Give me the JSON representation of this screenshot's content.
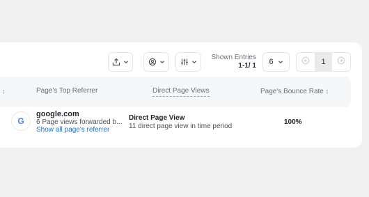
{
  "toolbar": {
    "export_icon": "export-icon",
    "filter_icon": "person-filter-icon",
    "columns_icon": "sliders-icon",
    "dropdown_icon": "chevron-down-icon"
  },
  "entries": {
    "label": "Shown Entries",
    "range": "1-1/ 1",
    "per_page": "6"
  },
  "pagination": {
    "current_page": "1"
  },
  "table": {
    "headers": {
      "referrer": "Page's Top Referrer",
      "views": "Direct Page Views",
      "bounce": "Page's Bounce Rate",
      "sort_symbol": "↕"
    },
    "rows": [
      {
        "icon_letter": "G",
        "domain": "google.com",
        "subtitle": "6 Page views forwarded b...",
        "link": "Show all page's referrer",
        "views_title": "Direct Page View",
        "views_subtitle": "11 direct page view in time period",
        "bounce_rate": "100%"
      }
    ]
  }
}
